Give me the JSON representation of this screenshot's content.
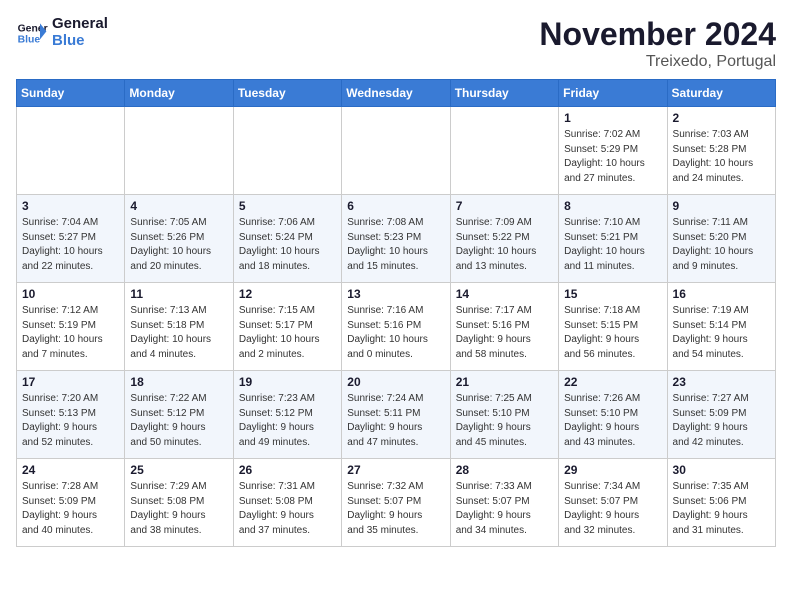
{
  "logo": {
    "line1": "General",
    "line2": "Blue"
  },
  "title": "November 2024",
  "location": "Treixedo, Portugal",
  "days_of_week": [
    "Sunday",
    "Monday",
    "Tuesday",
    "Wednesday",
    "Thursday",
    "Friday",
    "Saturday"
  ],
  "weeks": [
    [
      {
        "day": "",
        "info": ""
      },
      {
        "day": "",
        "info": ""
      },
      {
        "day": "",
        "info": ""
      },
      {
        "day": "",
        "info": ""
      },
      {
        "day": "",
        "info": ""
      },
      {
        "day": "1",
        "info": "Sunrise: 7:02 AM\nSunset: 5:29 PM\nDaylight: 10 hours\nand 27 minutes."
      },
      {
        "day": "2",
        "info": "Sunrise: 7:03 AM\nSunset: 5:28 PM\nDaylight: 10 hours\nand 24 minutes."
      }
    ],
    [
      {
        "day": "3",
        "info": "Sunrise: 7:04 AM\nSunset: 5:27 PM\nDaylight: 10 hours\nand 22 minutes."
      },
      {
        "day": "4",
        "info": "Sunrise: 7:05 AM\nSunset: 5:26 PM\nDaylight: 10 hours\nand 20 minutes."
      },
      {
        "day": "5",
        "info": "Sunrise: 7:06 AM\nSunset: 5:24 PM\nDaylight: 10 hours\nand 18 minutes."
      },
      {
        "day": "6",
        "info": "Sunrise: 7:08 AM\nSunset: 5:23 PM\nDaylight: 10 hours\nand 15 minutes."
      },
      {
        "day": "7",
        "info": "Sunrise: 7:09 AM\nSunset: 5:22 PM\nDaylight: 10 hours\nand 13 minutes."
      },
      {
        "day": "8",
        "info": "Sunrise: 7:10 AM\nSunset: 5:21 PM\nDaylight: 10 hours\nand 11 minutes."
      },
      {
        "day": "9",
        "info": "Sunrise: 7:11 AM\nSunset: 5:20 PM\nDaylight: 10 hours\nand 9 minutes."
      }
    ],
    [
      {
        "day": "10",
        "info": "Sunrise: 7:12 AM\nSunset: 5:19 PM\nDaylight: 10 hours\nand 7 minutes."
      },
      {
        "day": "11",
        "info": "Sunrise: 7:13 AM\nSunset: 5:18 PM\nDaylight: 10 hours\nand 4 minutes."
      },
      {
        "day": "12",
        "info": "Sunrise: 7:15 AM\nSunset: 5:17 PM\nDaylight: 10 hours\nand 2 minutes."
      },
      {
        "day": "13",
        "info": "Sunrise: 7:16 AM\nSunset: 5:16 PM\nDaylight: 10 hours\nand 0 minutes."
      },
      {
        "day": "14",
        "info": "Sunrise: 7:17 AM\nSunset: 5:16 PM\nDaylight: 9 hours\nand 58 minutes."
      },
      {
        "day": "15",
        "info": "Sunrise: 7:18 AM\nSunset: 5:15 PM\nDaylight: 9 hours\nand 56 minutes."
      },
      {
        "day": "16",
        "info": "Sunrise: 7:19 AM\nSunset: 5:14 PM\nDaylight: 9 hours\nand 54 minutes."
      }
    ],
    [
      {
        "day": "17",
        "info": "Sunrise: 7:20 AM\nSunset: 5:13 PM\nDaylight: 9 hours\nand 52 minutes."
      },
      {
        "day": "18",
        "info": "Sunrise: 7:22 AM\nSunset: 5:12 PM\nDaylight: 9 hours\nand 50 minutes."
      },
      {
        "day": "19",
        "info": "Sunrise: 7:23 AM\nSunset: 5:12 PM\nDaylight: 9 hours\nand 49 minutes."
      },
      {
        "day": "20",
        "info": "Sunrise: 7:24 AM\nSunset: 5:11 PM\nDaylight: 9 hours\nand 47 minutes."
      },
      {
        "day": "21",
        "info": "Sunrise: 7:25 AM\nSunset: 5:10 PM\nDaylight: 9 hours\nand 45 minutes."
      },
      {
        "day": "22",
        "info": "Sunrise: 7:26 AM\nSunset: 5:10 PM\nDaylight: 9 hours\nand 43 minutes."
      },
      {
        "day": "23",
        "info": "Sunrise: 7:27 AM\nSunset: 5:09 PM\nDaylight: 9 hours\nand 42 minutes."
      }
    ],
    [
      {
        "day": "24",
        "info": "Sunrise: 7:28 AM\nSunset: 5:09 PM\nDaylight: 9 hours\nand 40 minutes."
      },
      {
        "day": "25",
        "info": "Sunrise: 7:29 AM\nSunset: 5:08 PM\nDaylight: 9 hours\nand 38 minutes."
      },
      {
        "day": "26",
        "info": "Sunrise: 7:31 AM\nSunset: 5:08 PM\nDaylight: 9 hours\nand 37 minutes."
      },
      {
        "day": "27",
        "info": "Sunrise: 7:32 AM\nSunset: 5:07 PM\nDaylight: 9 hours\nand 35 minutes."
      },
      {
        "day": "28",
        "info": "Sunrise: 7:33 AM\nSunset: 5:07 PM\nDaylight: 9 hours\nand 34 minutes."
      },
      {
        "day": "29",
        "info": "Sunrise: 7:34 AM\nSunset: 5:07 PM\nDaylight: 9 hours\nand 32 minutes."
      },
      {
        "day": "30",
        "info": "Sunrise: 7:35 AM\nSunset: 5:06 PM\nDaylight: 9 hours\nand 31 minutes."
      }
    ]
  ]
}
